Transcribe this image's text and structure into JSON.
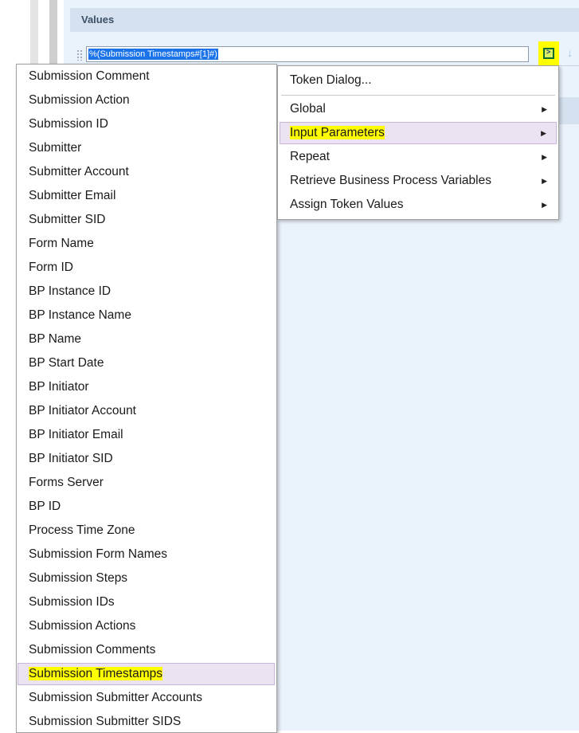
{
  "values_section": {
    "title": "Values",
    "input_value": "%(Submission Timestamps#[1]#)",
    "token_button_label": ">",
    "down_arrow": "↓"
  },
  "context_menu": {
    "items": [
      {
        "label": "Token Dialog...",
        "submenu": false
      },
      {
        "label": "Global",
        "submenu": true,
        "arrow": "▶"
      },
      {
        "label": "Input Parameters",
        "submenu": true,
        "arrow": "▶",
        "highlighted": true
      },
      {
        "label": "Repeat",
        "submenu": true,
        "arrow": "▶"
      },
      {
        "label": "Retrieve Business Process Variables",
        "submenu": true,
        "arrow": "▶"
      },
      {
        "label": "Assign Token Values",
        "submenu": true,
        "arrow": "▶"
      }
    ]
  },
  "token_list": {
    "items": [
      "Submission Comment",
      "Submission Action",
      "Submission ID",
      "Submitter",
      "Submitter Account",
      "Submitter Email",
      "Submitter SID",
      "Form Name",
      "Form ID",
      "BP Instance ID",
      "BP Instance Name",
      "BP Name",
      "BP Start Date",
      "BP Initiator",
      "BP Initiator Account",
      "BP Initiator Email",
      "BP Initiator SID",
      "Forms Server",
      "BP ID",
      "Process Time Zone",
      "Submission Form Names",
      "Submission Steps",
      "Submission IDs",
      "Submission Actions",
      "Submission Comments",
      "Submission Timestamps",
      "Submission Submitter Accounts",
      "Submission Submitter SIDS"
    ],
    "highlighted_item": "Submission Timestamps"
  },
  "colors": {
    "panel_bg": "#eaf2fb",
    "header_bg": "#d5e1ef",
    "highlight_yellow": "#ffff00",
    "menu_hover": "#ece3f2",
    "selection_blue": "#1a73e8"
  }
}
